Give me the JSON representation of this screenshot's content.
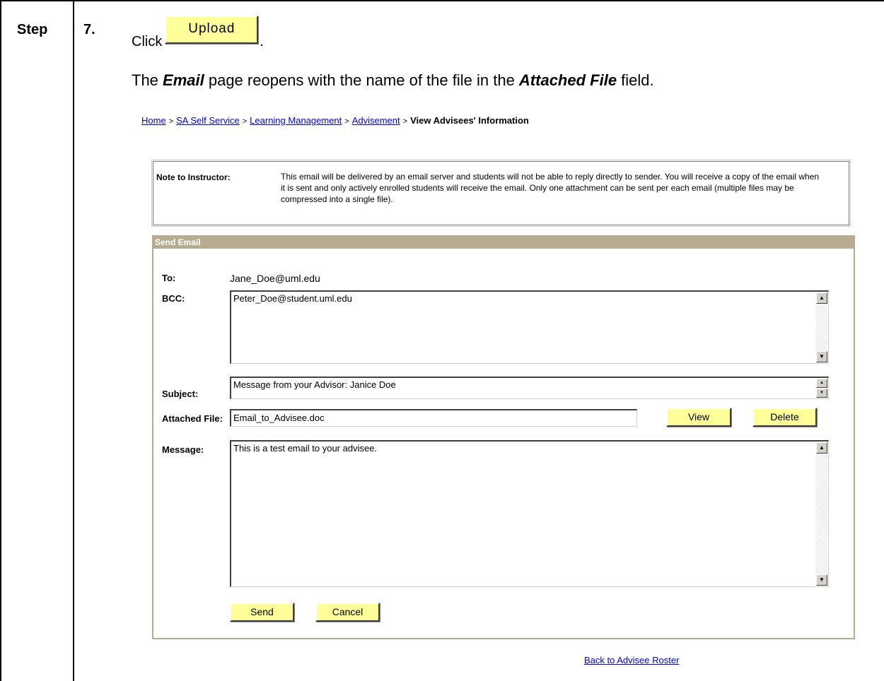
{
  "step": {
    "label": "Step",
    "number": "7."
  },
  "instructions": {
    "click_word": "Click",
    "upload_button_label": "Upload",
    "click_period": ".",
    "line2_prefix": "The ",
    "line2_page": "Email",
    "line2_middle": " page reopens with the name of the file in the ",
    "line2_field": "Attached File",
    "line2_suffix": " field."
  },
  "breadcrumb": {
    "home": "Home",
    "sa_self_service": "SA Self Service",
    "learning_management": "Learning Management",
    "advisement": "Advisement",
    "current": "View Advisees' Information",
    "separator": ">"
  },
  "note": {
    "label": "Note to Instructor:",
    "text": "This email will be delivered by an email server and students will not be able to reply directly to sender. You will receive a copy of the email when it is sent and only actively enrolled students will receive the email. Only one attachment can be sent per each email (multiple files may be compressed into a single file)."
  },
  "send_email": {
    "header": "Send Email",
    "to_label": "To:",
    "to_value": "Jane_Doe@uml.edu",
    "bcc_label": "BCC:",
    "bcc_value": "Peter_Doe@student.uml.edu",
    "subject_label": "Subject:",
    "subject_value": "Message from your Advisor: Janice Doe",
    "attached_label": "Attached File:",
    "attached_value": "Email_to_Advisee.doc",
    "view_label": "View",
    "delete_label": "Delete",
    "message_label": "Message:",
    "message_value": "This is a test email to your advisee.",
    "send_label": "Send",
    "cancel_label": "Cancel"
  },
  "back_link": "Back to Advisee Roster",
  "icons": {
    "scroll_up": "scroll-up-arrow-icon",
    "scroll_down": "scroll-down-arrow-icon"
  },
  "colors": {
    "button_bg": "#ffff99",
    "panel_header": "#b7ac91",
    "link": "#0000ee"
  }
}
